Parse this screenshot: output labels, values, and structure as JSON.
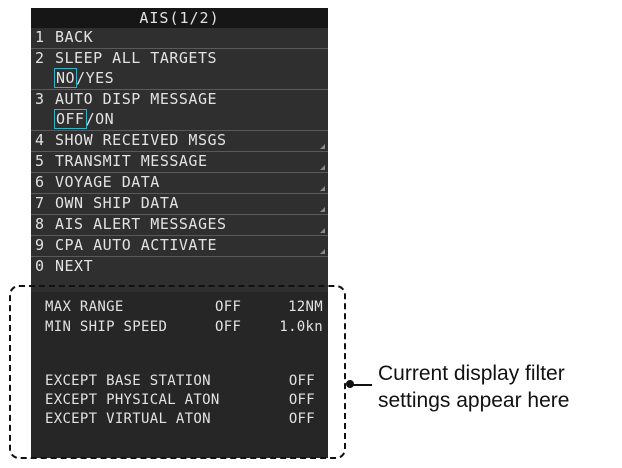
{
  "menu": {
    "title": "AIS(1/2)",
    "items": [
      {
        "num": "1",
        "label": "BACK"
      },
      {
        "num": "2",
        "label": "SLEEP ALL TARGETS",
        "option_selected": "NO",
        "option_rest": "/YES"
      },
      {
        "num": "3",
        "label": "AUTO DISP MESSAGE",
        "option_selected": "OFF",
        "option_rest": "/ON"
      },
      {
        "num": "4",
        "label": "SHOW RECEIVED MSGS"
      },
      {
        "num": "5",
        "label": "TRANSMIT MESSAGE"
      },
      {
        "num": "6",
        "label": "VOYAGE DATA"
      },
      {
        "num": "7",
        "label": "OWN SHIP DATA"
      },
      {
        "num": "8",
        "label": "AIS ALERT MESSAGES"
      },
      {
        "num": "9",
        "label": "CPA AUTO ACTIVATE"
      },
      {
        "num": "0",
        "label": "NEXT"
      }
    ]
  },
  "filter": {
    "max_range": {
      "label": "MAX RANGE",
      "state": "OFF",
      "value": "12NM"
    },
    "min_ship_speed": {
      "label": "MIN SHIP SPEED",
      "state": "OFF",
      "value": "1.0kn"
    },
    "except_base_station": {
      "label": "EXCEPT BASE STATION",
      "state": "OFF"
    },
    "except_physical_aton": {
      "label": "EXCEPT PHYSICAL ATON",
      "state": "OFF"
    },
    "except_virtual_aton": {
      "label": "EXCEPT VIRTUAL ATON",
      "state": "OFF"
    }
  },
  "callout": {
    "line1": "Current display filter",
    "line2": "settings appear here"
  }
}
